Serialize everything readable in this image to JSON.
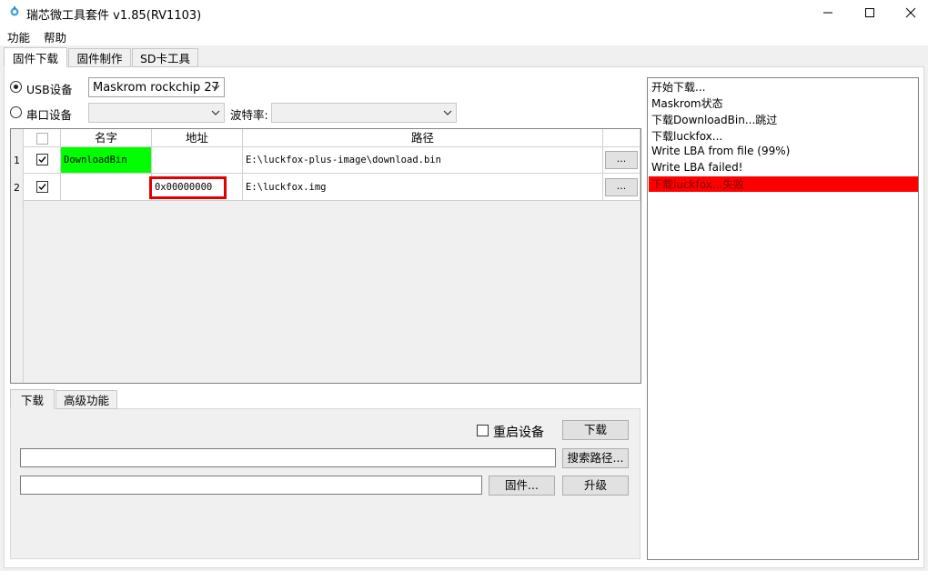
{
  "window": {
    "title": "瑞芯微工具套件 v1.85(RV1103)",
    "icon": "app-gear-icon"
  },
  "menu": [
    "功能",
    "帮助"
  ],
  "main_tabs": [
    "固件下载",
    "固件制作",
    "SD卡工具"
  ],
  "device": {
    "usb_label": "USB设备",
    "usb_selected": true,
    "usb_value": "Maskrom rockchip 27",
    "serial_label": "串口设备",
    "serial_value": "",
    "baud_label": "波特率:",
    "baud_value": ""
  },
  "table": {
    "headers": [
      "名字",
      "地址",
      "路径"
    ],
    "rows": [
      {
        "index": "1",
        "checked": true,
        "name": "DownloadBin",
        "name_highlight": "#00ff00",
        "address": "",
        "path": "E:\\luckfox-plus-image\\download.bin",
        "browse": "..."
      },
      {
        "index": "2",
        "checked": true,
        "name": "",
        "address": "0x00000000",
        "address_highlight_border": "#e00000",
        "path": "E:\\luckfox.img",
        "browse": "..."
      }
    ]
  },
  "bottom_tabs": [
    "下载",
    "高级功能"
  ],
  "bottom": {
    "reboot_label": "重启设备",
    "reboot_checked": false,
    "download_button": "下载",
    "search_path_button": "搜索路径...",
    "firmware_button": "固件...",
    "upgrade_button": "升级",
    "path_value": "",
    "firmware_value": ""
  },
  "log": {
    "lines": [
      "开始下载...",
      "Maskrom状态",
      "下载DownloadBin...跳过",
      "下载luckfox...",
      "Write LBA from file (99%)",
      "Write LBA failed!",
      "下载luckfox...失败"
    ],
    "error_color": "#ff0000"
  }
}
